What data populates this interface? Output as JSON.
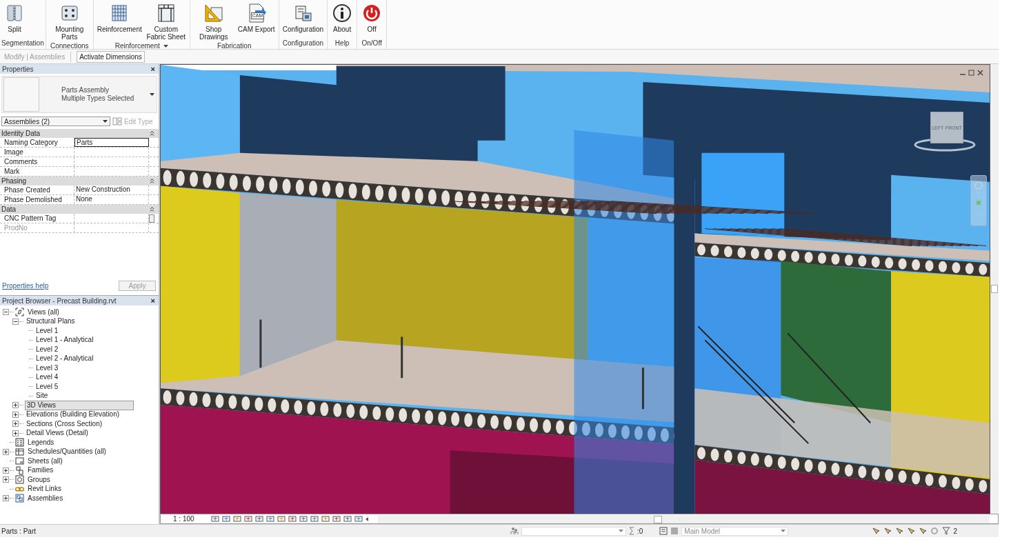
{
  "ribbon": {
    "panels": [
      {
        "label": "Segmentation",
        "menu": false,
        "buttons": [
          {
            "label": "Split",
            "kind": "split"
          }
        ]
      },
      {
        "label": "Connections",
        "menu": false,
        "buttons": [
          {
            "label": "Mounting Parts",
            "kind": "mounting"
          }
        ]
      },
      {
        "label": "Reinforcement",
        "menu": true,
        "buttons": [
          {
            "label": "Reinforcement",
            "kind": "reinforcement"
          },
          {
            "label": "Custom Fabric Sheet",
            "kind": "fabric"
          }
        ]
      },
      {
        "label": "Fabrication",
        "menu": false,
        "buttons": [
          {
            "label": "Shop Drawings",
            "kind": "shop"
          },
          {
            "label": "CAM Export",
            "kind": "cam",
            "badge": "CAM"
          }
        ]
      },
      {
        "label": "Configuration",
        "menu": false,
        "buttons": [
          {
            "label": "Configuration",
            "kind": "config"
          }
        ]
      },
      {
        "label": "Help",
        "menu": false,
        "buttons": [
          {
            "label": "About",
            "kind": "about"
          }
        ]
      },
      {
        "label": "On/Off",
        "menu": false,
        "buttons": [
          {
            "label": "Off",
            "kind": "power"
          }
        ]
      }
    ]
  },
  "options_bar": {
    "context": "Modify | Assemblies",
    "button": "Activate Dimensions"
  },
  "properties": {
    "title": "Properties",
    "close": "×",
    "type_name": "Parts Assembly",
    "type_detail": "Multiple Types Selected",
    "selector": "Assemblies (2)",
    "edit_type": {
      "label": "Edit Type",
      "disabled": true
    },
    "groups": [
      {
        "name": "Identity Data",
        "rows": [
          {
            "name": "Naming Category",
            "value": "Parts",
            "active": true,
            "disabled": false,
            "browse": false
          },
          {
            "name": "Image",
            "active": false,
            "disabled": false,
            "browse": false
          },
          {
            "name": "Comments",
            "active": false,
            "disabled": false,
            "browse": false
          },
          {
            "name": "Mark",
            "active": false,
            "disabled": false,
            "browse": false
          }
        ]
      },
      {
        "name": "Phasing",
        "rows": [
          {
            "name": "Phase Created",
            "value": "New Construction",
            "active": false,
            "disabled": false,
            "browse": false
          },
          {
            "name": "Phase Demolished",
            "value": "None",
            "active": false,
            "disabled": false,
            "browse": false
          }
        ]
      },
      {
        "name": "Data",
        "rows": [
          {
            "name": "CNC Pattern Tag",
            "active": false,
            "disabled": false,
            "browse": true
          },
          {
            "name": "ProdNo",
            "active": false,
            "disabled": true,
            "browse": false
          }
        ]
      }
    ],
    "help_link": "Properties help",
    "apply": {
      "label": "Apply",
      "disabled": true
    }
  },
  "project_browser": {
    "title": "Project Browser - Precast Building.rvt",
    "close": "×",
    "tree": [
      {
        "label": "Views (all)",
        "kind": "views",
        "expanded": true,
        "selected": false,
        "children": [
          {
            "label": "Structural Plans",
            "expanded": true,
            "selected": false,
            "children": [
              {
                "label": "Level 1",
                "selected": false
              },
              {
                "label": "Level 1 - Analytical",
                "selected": false
              },
              {
                "label": "Level 2",
                "selected": false
              },
              {
                "label": "Level 2 - Analytical",
                "selected": false
              },
              {
                "label": "Level 3",
                "selected": false
              },
              {
                "label": "Level 4",
                "selected": false
              },
              {
                "label": "Level 5",
                "selected": false
              },
              {
                "label": "Site",
                "selected": false
              }
            ]
          },
          {
            "label": "3D Views",
            "expanded": false,
            "selected": true
          },
          {
            "label": "Elevations (Building Elevation)",
            "expanded": false,
            "selected": false
          },
          {
            "label": "Sections (Cross Section)",
            "expanded": false,
            "selected": false
          },
          {
            "label": "Detail Views (Detail)",
            "expanded": false,
            "selected": false
          }
        ]
      },
      {
        "label": "Legends",
        "kind": "legend",
        "selected": false
      },
      {
        "label": "Schedules/Quantities (all)",
        "kind": "schedule",
        "expanded": false,
        "selected": false
      },
      {
        "label": "Sheets (all)",
        "kind": "sheet",
        "selected": false
      },
      {
        "label": "Families",
        "kind": "family",
        "expanded": false,
        "selected": false
      },
      {
        "label": "Groups",
        "kind": "group",
        "expanded": false,
        "selected": false
      },
      {
        "label": "Revit Links",
        "kind": "link",
        "selected": false
      },
      {
        "label": "Assemblies",
        "kind": "assembly",
        "expanded": false,
        "selected": false
      }
    ]
  },
  "view": {
    "viewcube": {
      "left": "LEFT",
      "front": "FRONT"
    },
    "scale": "1 : 100"
  },
  "status_bar": {
    "text": "Parts : Part",
    "selection_count": ":0",
    "model": "Main Model",
    "filter_count": "2"
  }
}
